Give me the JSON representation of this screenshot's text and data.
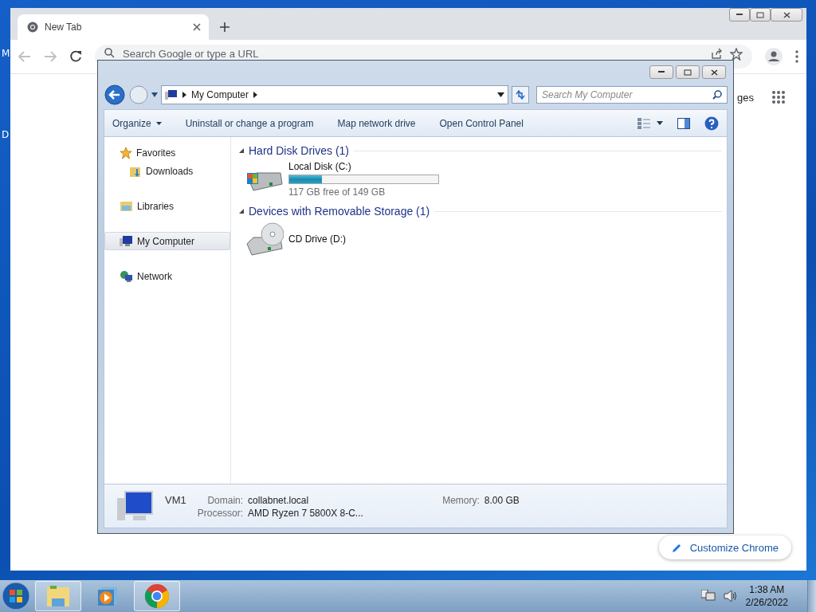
{
  "desktop": {
    "icon_labels": [
      "M",
      "D"
    ]
  },
  "chrome": {
    "tabs": [
      {
        "title": "New Tab",
        "selected": true
      }
    ],
    "omnibox": {
      "placeholder": "Search Google or type a URL"
    },
    "link_partial": "ges",
    "customize_button": "Customize Chrome"
  },
  "explorer": {
    "address": {
      "segments": [
        "My Computer"
      ]
    },
    "search": {
      "placeholder": "Search My Computer"
    },
    "commands": [
      {
        "label": "Organize",
        "kind": "menu"
      },
      {
        "label": "Uninstall or change a program",
        "kind": "plain"
      },
      {
        "label": "Map network drive",
        "kind": "plain"
      },
      {
        "label": "Open Control Panel",
        "kind": "plain"
      }
    ],
    "nav": [
      {
        "label": "Favorites",
        "kind": "favorites",
        "selected": false,
        "children": [
          {
            "label": "Downloads",
            "kind": "folder",
            "selected": false
          }
        ]
      },
      {
        "label": "Libraries",
        "kind": "libraries",
        "selected": false
      },
      {
        "label": "My Computer",
        "kind": "computer",
        "selected": true
      },
      {
        "label": "Network",
        "kind": "network",
        "selected": false
      }
    ],
    "groups": [
      {
        "title": "Hard Disk Drives (1)",
        "items": [
          {
            "name": "Local Disk (C:)",
            "kind": "disk",
            "level": 0.22,
            "reading": "117 GB free of 149 GB"
          }
        ]
      },
      {
        "title": "Devices with Removable Storage (1)",
        "items": [
          {
            "name": "CD Drive (D:)",
            "kind": "cd"
          }
        ]
      }
    ],
    "details": {
      "name": "VM1",
      "fields": [
        {
          "label": "Domain:",
          "value": "collabnet.local"
        },
        {
          "label": "Memory:",
          "value": "8.00 GB"
        },
        {
          "label": "Processor:",
          "value": "AMD Ryzen 7 5800X 8-C..."
        }
      ]
    }
  },
  "taskbar": {
    "buttons": [
      {
        "kind": "explorer",
        "running": true
      },
      {
        "kind": "media",
        "running": false
      },
      {
        "kind": "chrome",
        "running": true
      }
    ],
    "clock": {
      "time": "1:38 AM",
      "date": "2/26/2022"
    }
  }
}
